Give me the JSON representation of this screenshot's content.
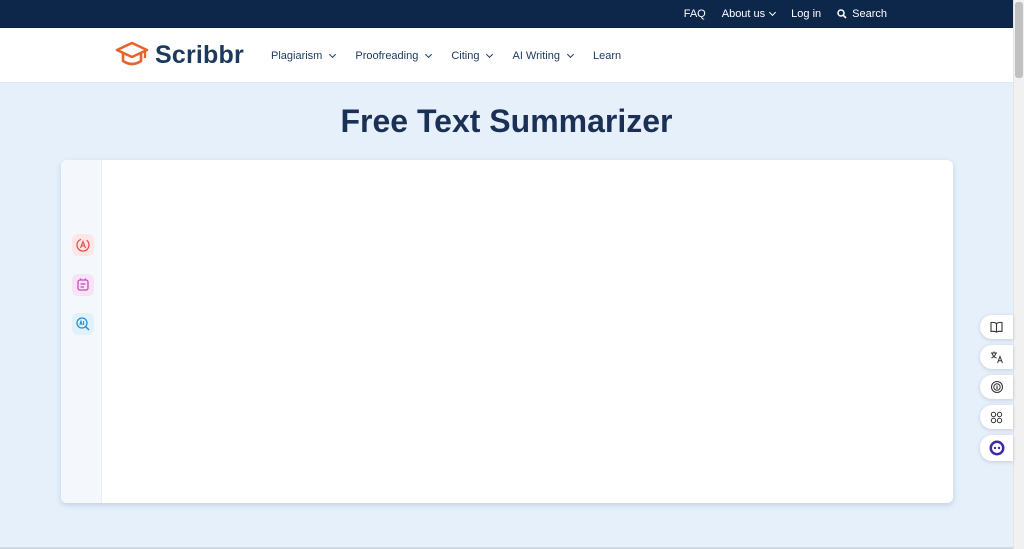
{
  "topbar": {
    "faq": "FAQ",
    "about": "About us",
    "login": "Log in",
    "search": "Search"
  },
  "nav": {
    "brand": "Scribbr",
    "items": [
      {
        "label": "Plagiarism",
        "dropdown": true
      },
      {
        "label": "Proofreading",
        "dropdown": true
      },
      {
        "label": "Citing",
        "dropdown": true
      },
      {
        "label": "AI Writing",
        "dropdown": true
      },
      {
        "label": "Learn",
        "dropdown": false
      }
    ]
  },
  "page": {
    "title": "Free Text Summarizer"
  },
  "tools": [
    "paraphrase-icon",
    "summarize-icon",
    "ai-detect-icon"
  ],
  "floating": [
    "book-icon",
    "translate-icon",
    "fingerprint-icon",
    "apps-icon",
    "chat-bot-icon"
  ],
  "colors": {
    "topbar": "#0c2749",
    "brand_orange": "#e8632c",
    "brand_navy": "#1b3a5e",
    "page_bg": "#e6f0fb"
  }
}
